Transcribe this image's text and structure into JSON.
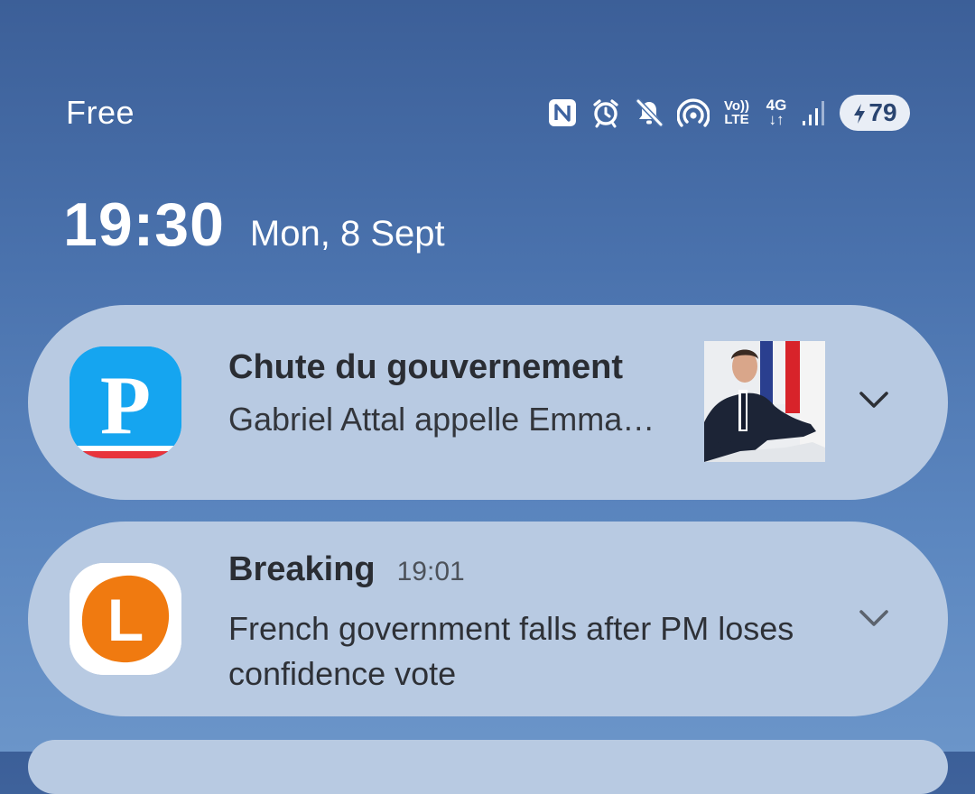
{
  "status_bar": {
    "carrier": "Free",
    "icons": [
      "nfc-icon",
      "alarm-icon",
      "mute-icon",
      "hotspot-icon",
      "volte-icon",
      "network-4g-icon",
      "signal-icon",
      "battery-charging-icon"
    ],
    "volte_top": "Vo))",
    "volte_bottom": "LTE",
    "network_top": "4G",
    "network_bottom": "↓↑",
    "battery_level": "79"
  },
  "lockscreen": {
    "time": "19:30",
    "date": "Mon, 8 Sept"
  },
  "notifications": [
    {
      "app_icon": "parisien-app-icon",
      "app_letter": "P",
      "title": "Chute du gouvernement",
      "body": "Gabriel Attal appelle Emma…",
      "has_thumbnail": true
    },
    {
      "app_icon": "lci-app-icon",
      "app_letter": "L",
      "title": "Breaking",
      "time": "19:01",
      "body": "French government falls after PM loses confidence vote"
    }
  ],
  "colors": {
    "background_top": "#3c5f98",
    "background_bottom": "#6b95c9",
    "card": "#b8cae2",
    "parisien_blue": "#15a5f0",
    "lci_orange": "#f07a10"
  }
}
